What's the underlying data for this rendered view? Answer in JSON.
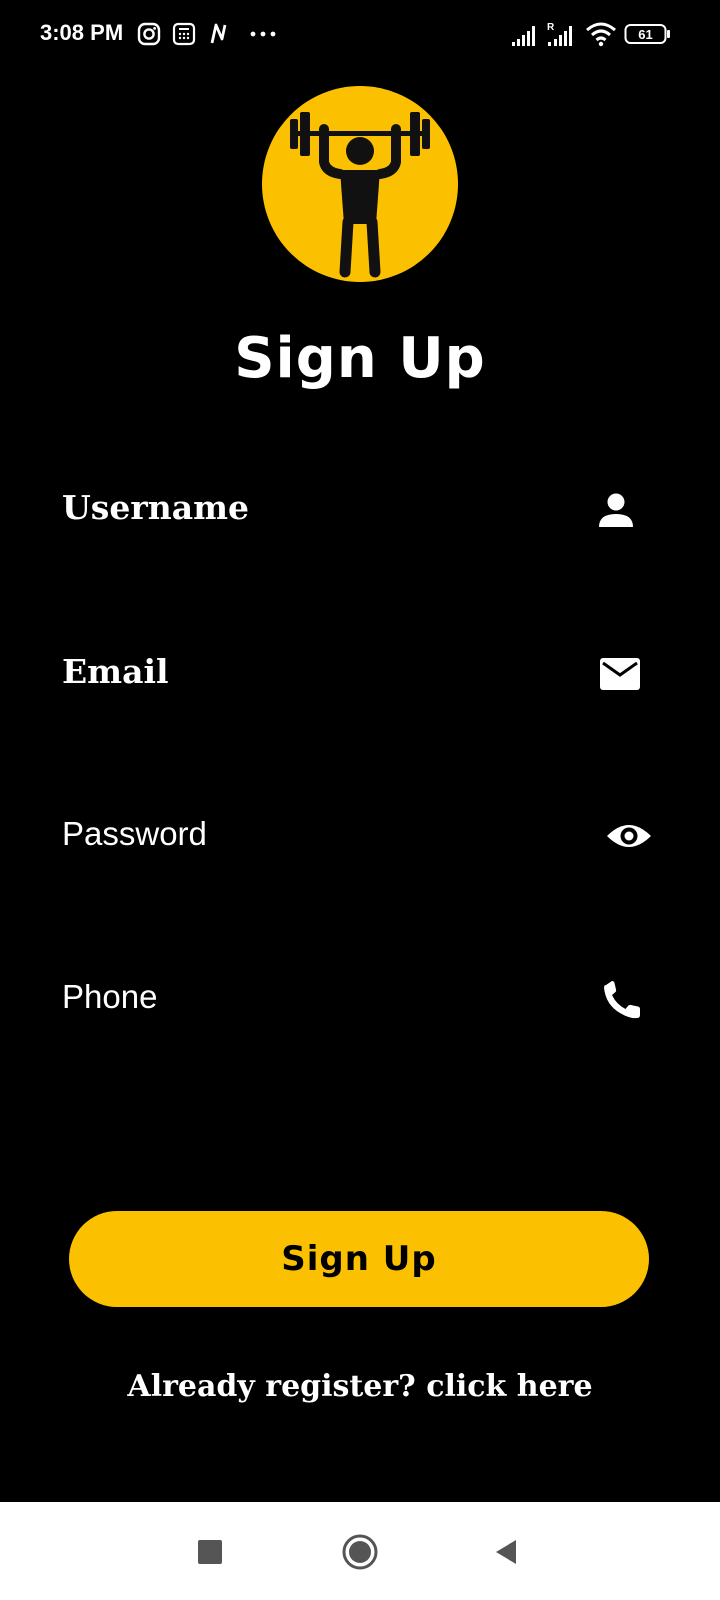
{
  "status_bar": {
    "time": "3:08 PM",
    "battery_level": "61",
    "icons": [
      "instagram-icon",
      "calculator-icon",
      "n-app-icon",
      "more-dots-icon",
      "signal-icon",
      "signal-roaming-icon",
      "wifi-icon",
      "battery-icon"
    ]
  },
  "logo": {
    "icon": "weightlifter-icon",
    "background_color": "#fbc100"
  },
  "title": "Sign Up",
  "form": {
    "username": {
      "label": "Username",
      "icon": "person-icon"
    },
    "email": {
      "label": "Email",
      "icon": "mail-icon"
    },
    "password": {
      "label": "Password",
      "icon": "eye-icon"
    },
    "phone": {
      "label": "Phone",
      "icon": "phone-icon"
    }
  },
  "submit_button": {
    "label": "Sign Up",
    "color": "#fbc100"
  },
  "login_link": "Already register? click here",
  "nav_bar": {
    "icons": [
      "recents-square-icon",
      "home-circle-icon",
      "back-triangle-icon"
    ]
  }
}
